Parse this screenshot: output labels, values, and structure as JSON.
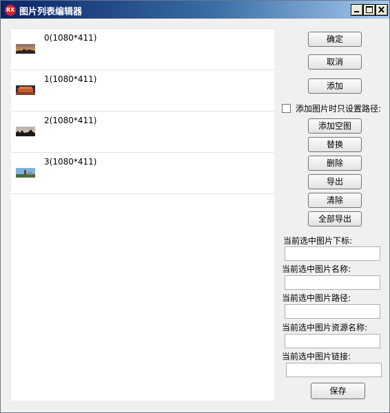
{
  "window": {
    "title": "图片列表编辑器",
    "app_icon_text": "RX"
  },
  "image_list": {
    "items": [
      {
        "label": "0(1080*411)",
        "thumbnail": "sunset-skyline-thumbnail"
      },
      {
        "label": "1(1080*411)",
        "thumbnail": "lit-building-night-thumbnail"
      },
      {
        "label": "2(1080*411)",
        "thumbnail": "dusk-trees-thumbnail"
      },
      {
        "label": "3(1080*411)",
        "thumbnail": "pagoda-skyline-thumbnail"
      }
    ]
  },
  "buttons": {
    "confirm": "确定",
    "cancel": "取消",
    "add": "添加",
    "add_empty": "添加空图",
    "replace": "替换",
    "delete": "删除",
    "export": "导出",
    "clear": "清除",
    "export_all": "全部导出",
    "save": "保存"
  },
  "options": {
    "path_only_label": "添加图片时只设置路径:",
    "path_only_checked": false
  },
  "fields": {
    "index_label": "当前选中图片下标:",
    "index_value": "",
    "name_label": "当前选中图片名称:",
    "name_value": "",
    "path_label": "当前选中图片路径:",
    "path_value": "",
    "resource_label": "当前选中图片资源名称:",
    "resource_value": "",
    "link_label": "当前选中图片链接:",
    "link_value": ""
  }
}
